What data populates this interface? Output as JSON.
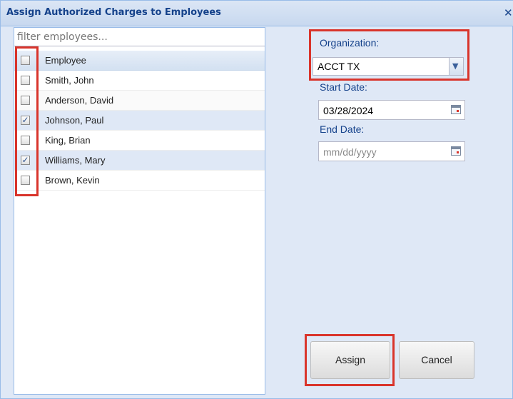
{
  "window": {
    "title": "Assign Authorized Charges to Employees"
  },
  "icons": {
    "close": "close-icon",
    "dropdown": "chevron-down-icon",
    "calendar": "calendar-icon",
    "check": "checkmark-icon"
  },
  "filter": {
    "placeholder": "filter employees...",
    "value": ""
  },
  "grid": {
    "header": "Employee",
    "rows": [
      {
        "name": "Smith, John",
        "checked": false
      },
      {
        "name": "Anderson, David",
        "checked": false
      },
      {
        "name": "Johnson, Paul",
        "checked": true
      },
      {
        "name": "King, Brian",
        "checked": false
      },
      {
        "name": "Williams, Mary",
        "checked": true
      },
      {
        "name": "Brown, Kevin",
        "checked": false
      }
    ]
  },
  "form": {
    "organization_label": "Organization:",
    "organization_value": "ACCT TX",
    "start_label": "Start Date:",
    "start_value": "03/28/2024",
    "end_label": "End Date:",
    "end_placeholder": "mm/dd/yyyy"
  },
  "buttons": {
    "assign": "Assign",
    "cancel": "Cancel"
  },
  "colors": {
    "title": "#15428b",
    "highlight": "#d9342b",
    "panel_bg": "#dfe8f6",
    "checked_row": "#dfe8f6"
  }
}
